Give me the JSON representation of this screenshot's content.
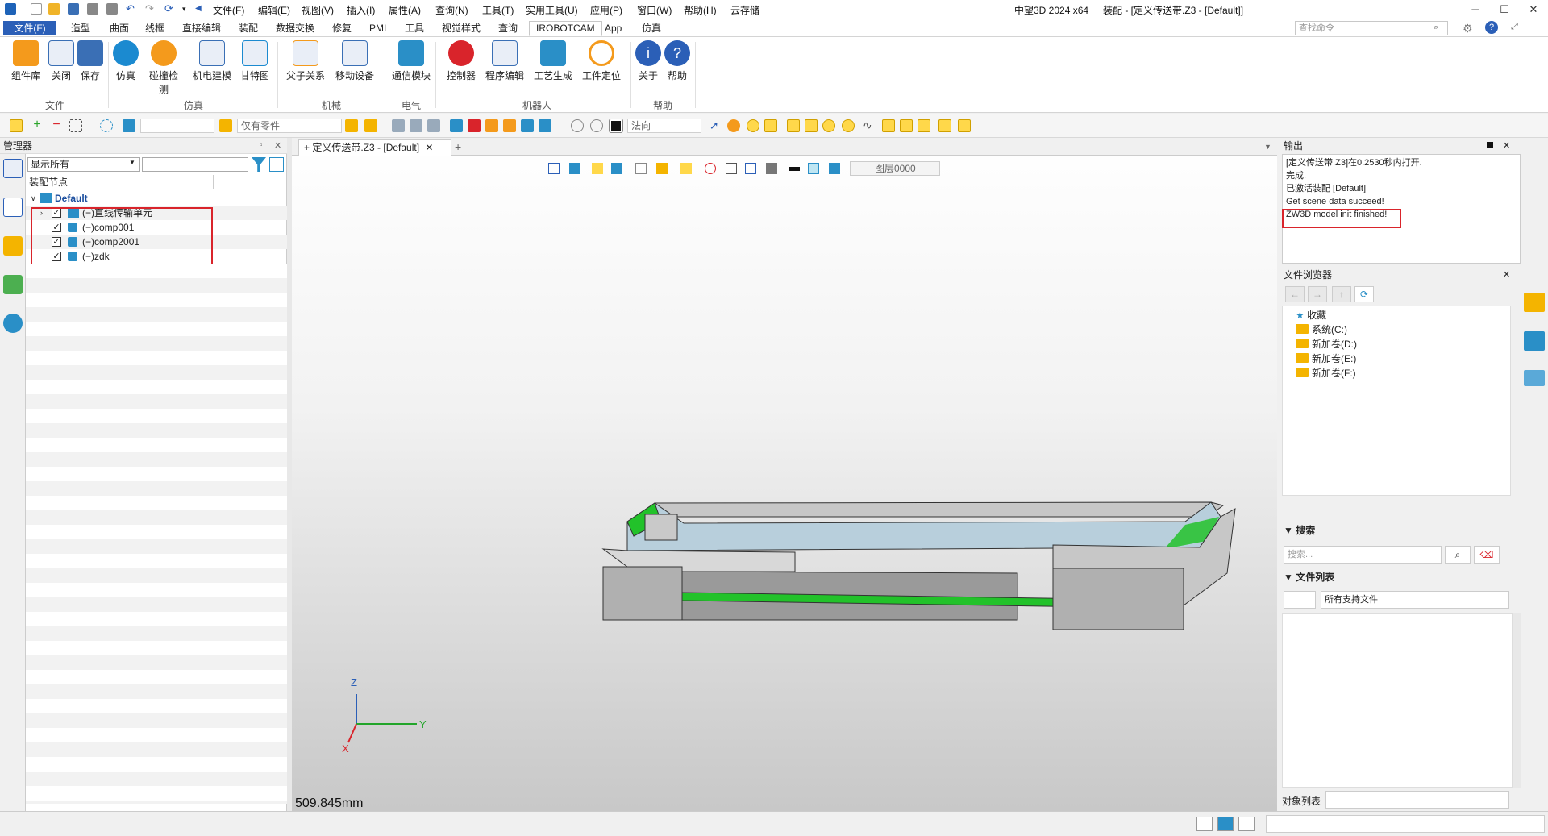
{
  "titlebar": {
    "menus": [
      "文件(F)",
      "编辑(E)",
      "视图(V)",
      "插入(I)",
      "属性(A)",
      "查询(N)",
      "工具(T)",
      "实用工具(U)",
      "应用(P)",
      "窗口(W)",
      "帮助(H)",
      "云存储"
    ],
    "app_name": "中望3D 2024 x64",
    "doc_title": "装配 - [定义传送带.Z3 - [Default]]",
    "search_placeholder": "查找命令"
  },
  "tabs": [
    "文件(F)",
    "造型",
    "曲面",
    "线框",
    "直接编辑",
    "装配",
    "数据交换",
    "修复",
    "PMI",
    "工具",
    "视觉样式",
    "查询",
    "IROBOTCAM",
    "App",
    "仿真"
  ],
  "ribbon": {
    "buttons": [
      "组件库",
      "关闭",
      "保存",
      "仿真",
      "碰撞检测",
      "机电建模",
      "甘特图",
      "父子关系",
      "移动设备",
      "通信模块",
      "控制器",
      "程序编辑",
      "工艺生成",
      "工件定位",
      "关于",
      "帮助"
    ],
    "groups": [
      "文件",
      "仿真",
      "机械",
      "电气",
      "机器人",
      "帮助"
    ]
  },
  "toolbar2": {
    "filter_value": "仅有零件",
    "direction_value": "法向",
    "layer_value": "图层0000"
  },
  "manager": {
    "title": "管理器",
    "show_filter": "显示所有",
    "column_header": "装配节点",
    "root": "Default",
    "nodes": [
      "(−)直线传输单元",
      "(−)comp001",
      "(−)comp2001",
      "(−)zdk"
    ]
  },
  "viewport": {
    "tab_title": "定义传送带.Z3 - [Default]",
    "scale_text": "509.845mm",
    "axis_x": "X",
    "axis_y": "Y",
    "axis_z": "Z"
  },
  "output": {
    "title": "输出",
    "lines": [
      "[定义传送带.Z3]在0.2530秒内打开.",
      "完成.",
      "已激活装配 [Default]",
      "Get scene data succeed!",
      "ZW3D model init finished!"
    ]
  },
  "file_browser": {
    "title": "文件浏览器",
    "items": [
      "收藏",
      "系统(C:)",
      "新加卷(D:)",
      "新加卷(E:)",
      "新加卷(F:)"
    ],
    "search_title": "搜索",
    "search_placeholder": "搜索...",
    "file_list_title": "文件列表",
    "file_filter": "所有支持文件",
    "object_list_label": "对象列表"
  },
  "colors": {
    "accent": "#2b5fb7",
    "highlight_box": "#d9242b",
    "belt_green": "#22c22a"
  }
}
